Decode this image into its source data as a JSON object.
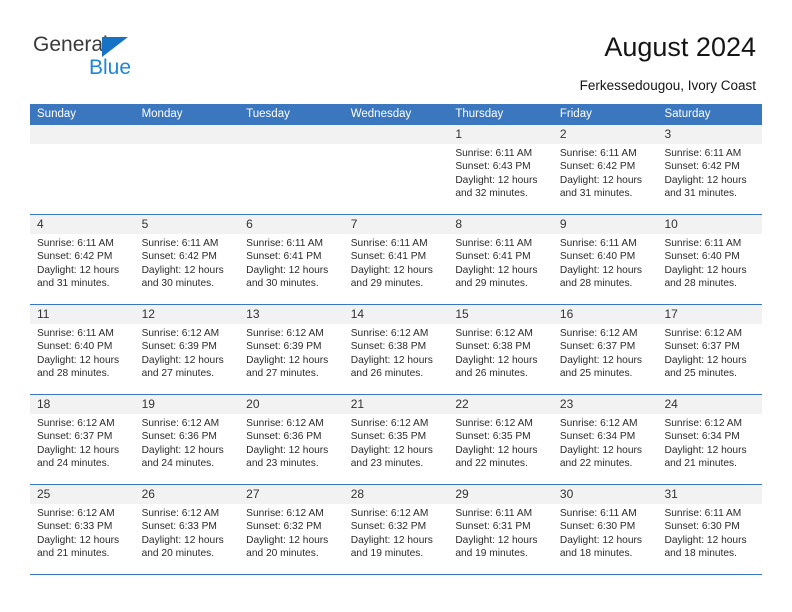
{
  "brand": {
    "name_part1": "General",
    "name_part2": "Blue",
    "triangle_color": "#1572c4",
    "blue_color": "#1f86d8"
  },
  "header": {
    "title": "August 2024",
    "subtitle": "Ferkessedougou, Ivory Coast"
  },
  "theme": {
    "header_blue": "#3b77bf",
    "daynum_band": "#f2f2f2",
    "grid_line": "#3b77bf"
  },
  "weekdays": [
    "Sunday",
    "Monday",
    "Tuesday",
    "Wednesday",
    "Thursday",
    "Friday",
    "Saturday"
  ],
  "weeks": [
    [
      {
        "day": "",
        "lines": []
      },
      {
        "day": "",
        "lines": []
      },
      {
        "day": "",
        "lines": []
      },
      {
        "day": "",
        "lines": []
      },
      {
        "day": "1",
        "lines": [
          "Sunrise: 6:11 AM",
          "Sunset: 6:43 PM",
          "Daylight: 12 hours",
          "and 32 minutes."
        ]
      },
      {
        "day": "2",
        "lines": [
          "Sunrise: 6:11 AM",
          "Sunset: 6:42 PM",
          "Daylight: 12 hours",
          "and 31 minutes."
        ]
      },
      {
        "day": "3",
        "lines": [
          "Sunrise: 6:11 AM",
          "Sunset: 6:42 PM",
          "Daylight: 12 hours",
          "and 31 minutes."
        ]
      }
    ],
    [
      {
        "day": "4",
        "lines": [
          "Sunrise: 6:11 AM",
          "Sunset: 6:42 PM",
          "Daylight: 12 hours",
          "and 31 minutes."
        ]
      },
      {
        "day": "5",
        "lines": [
          "Sunrise: 6:11 AM",
          "Sunset: 6:42 PM",
          "Daylight: 12 hours",
          "and 30 minutes."
        ]
      },
      {
        "day": "6",
        "lines": [
          "Sunrise: 6:11 AM",
          "Sunset: 6:41 PM",
          "Daylight: 12 hours",
          "and 30 minutes."
        ]
      },
      {
        "day": "7",
        "lines": [
          "Sunrise: 6:11 AM",
          "Sunset: 6:41 PM",
          "Daylight: 12 hours",
          "and 29 minutes."
        ]
      },
      {
        "day": "8",
        "lines": [
          "Sunrise: 6:11 AM",
          "Sunset: 6:41 PM",
          "Daylight: 12 hours",
          "and 29 minutes."
        ]
      },
      {
        "day": "9",
        "lines": [
          "Sunrise: 6:11 AM",
          "Sunset: 6:40 PM",
          "Daylight: 12 hours",
          "and 28 minutes."
        ]
      },
      {
        "day": "10",
        "lines": [
          "Sunrise: 6:11 AM",
          "Sunset: 6:40 PM",
          "Daylight: 12 hours",
          "and 28 minutes."
        ]
      }
    ],
    [
      {
        "day": "11",
        "lines": [
          "Sunrise: 6:11 AM",
          "Sunset: 6:40 PM",
          "Daylight: 12 hours",
          "and 28 minutes."
        ]
      },
      {
        "day": "12",
        "lines": [
          "Sunrise: 6:12 AM",
          "Sunset: 6:39 PM",
          "Daylight: 12 hours",
          "and 27 minutes."
        ]
      },
      {
        "day": "13",
        "lines": [
          "Sunrise: 6:12 AM",
          "Sunset: 6:39 PM",
          "Daylight: 12 hours",
          "and 27 minutes."
        ]
      },
      {
        "day": "14",
        "lines": [
          "Sunrise: 6:12 AM",
          "Sunset: 6:38 PM",
          "Daylight: 12 hours",
          "and 26 minutes."
        ]
      },
      {
        "day": "15",
        "lines": [
          "Sunrise: 6:12 AM",
          "Sunset: 6:38 PM",
          "Daylight: 12 hours",
          "and 26 minutes."
        ]
      },
      {
        "day": "16",
        "lines": [
          "Sunrise: 6:12 AM",
          "Sunset: 6:37 PM",
          "Daylight: 12 hours",
          "and 25 minutes."
        ]
      },
      {
        "day": "17",
        "lines": [
          "Sunrise: 6:12 AM",
          "Sunset: 6:37 PM",
          "Daylight: 12 hours",
          "and 25 minutes."
        ]
      }
    ],
    [
      {
        "day": "18",
        "lines": [
          "Sunrise: 6:12 AM",
          "Sunset: 6:37 PM",
          "Daylight: 12 hours",
          "and 24 minutes."
        ]
      },
      {
        "day": "19",
        "lines": [
          "Sunrise: 6:12 AM",
          "Sunset: 6:36 PM",
          "Daylight: 12 hours",
          "and 24 minutes."
        ]
      },
      {
        "day": "20",
        "lines": [
          "Sunrise: 6:12 AM",
          "Sunset: 6:36 PM",
          "Daylight: 12 hours",
          "and 23 minutes."
        ]
      },
      {
        "day": "21",
        "lines": [
          "Sunrise: 6:12 AM",
          "Sunset: 6:35 PM",
          "Daylight: 12 hours",
          "and 23 minutes."
        ]
      },
      {
        "day": "22",
        "lines": [
          "Sunrise: 6:12 AM",
          "Sunset: 6:35 PM",
          "Daylight: 12 hours",
          "and 22 minutes."
        ]
      },
      {
        "day": "23",
        "lines": [
          "Sunrise: 6:12 AM",
          "Sunset: 6:34 PM",
          "Daylight: 12 hours",
          "and 22 minutes."
        ]
      },
      {
        "day": "24",
        "lines": [
          "Sunrise: 6:12 AM",
          "Sunset: 6:34 PM",
          "Daylight: 12 hours",
          "and 21 minutes."
        ]
      }
    ],
    [
      {
        "day": "25",
        "lines": [
          "Sunrise: 6:12 AM",
          "Sunset: 6:33 PM",
          "Daylight: 12 hours",
          "and 21 minutes."
        ]
      },
      {
        "day": "26",
        "lines": [
          "Sunrise: 6:12 AM",
          "Sunset: 6:33 PM",
          "Daylight: 12 hours",
          "and 20 minutes."
        ]
      },
      {
        "day": "27",
        "lines": [
          "Sunrise: 6:12 AM",
          "Sunset: 6:32 PM",
          "Daylight: 12 hours",
          "and 20 minutes."
        ]
      },
      {
        "day": "28",
        "lines": [
          "Sunrise: 6:12 AM",
          "Sunset: 6:32 PM",
          "Daylight: 12 hours",
          "and 19 minutes."
        ]
      },
      {
        "day": "29",
        "lines": [
          "Sunrise: 6:11 AM",
          "Sunset: 6:31 PM",
          "Daylight: 12 hours",
          "and 19 minutes."
        ]
      },
      {
        "day": "30",
        "lines": [
          "Sunrise: 6:11 AM",
          "Sunset: 6:30 PM",
          "Daylight: 12 hours",
          "and 18 minutes."
        ]
      },
      {
        "day": "31",
        "lines": [
          "Sunrise: 6:11 AM",
          "Sunset: 6:30 PM",
          "Daylight: 12 hours",
          "and 18 minutes."
        ]
      }
    ]
  ]
}
